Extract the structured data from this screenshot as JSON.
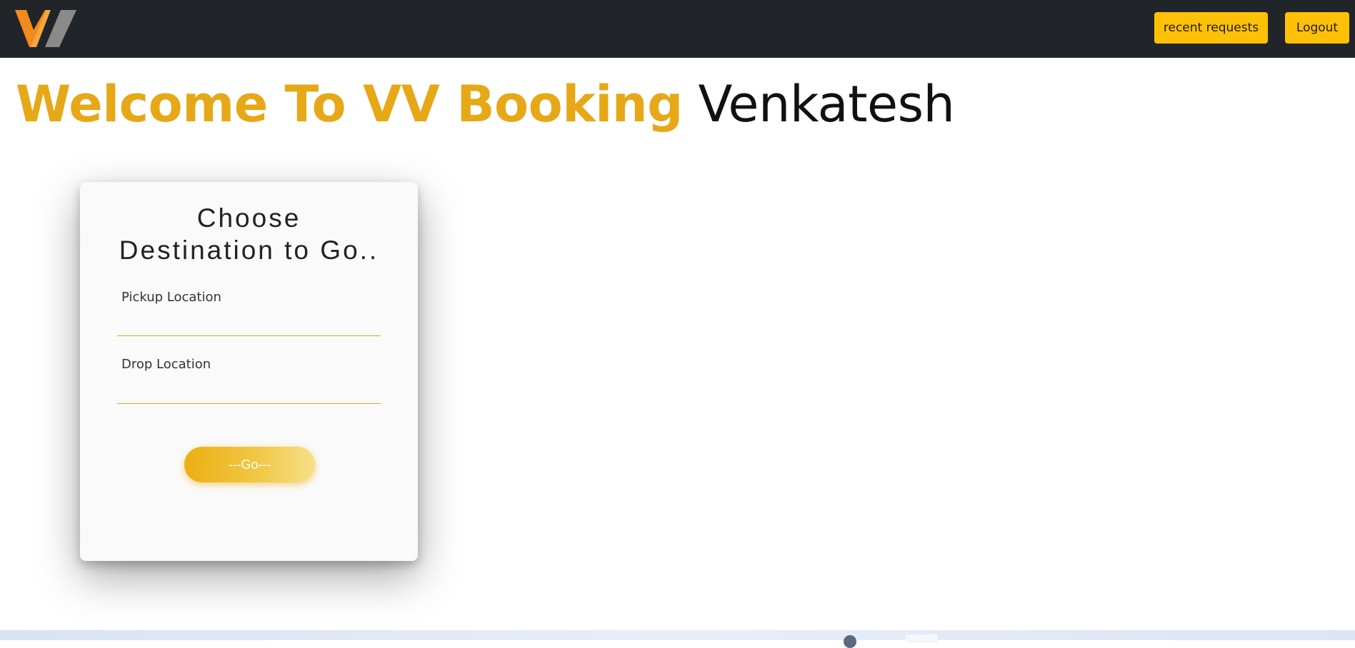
{
  "navbar": {
    "logo_icon": "vv-logo-icon",
    "recent_requests_label": "recent requests",
    "logout_label": "Logout"
  },
  "hero": {
    "welcome_text": "Welcome To VV Booking",
    "user_name": "Venkatesh"
  },
  "booking_card": {
    "title_line1": "Choose",
    "title_line2": "Destination to Go..",
    "pickup_label": "Pickup Location",
    "pickup_value": "",
    "drop_label": "Drop Location",
    "drop_value": "",
    "go_label": "---Go---"
  },
  "colors": {
    "navbar_bg": "#212529",
    "accent": "#e6a817",
    "button_yellow": "#ffc107"
  }
}
